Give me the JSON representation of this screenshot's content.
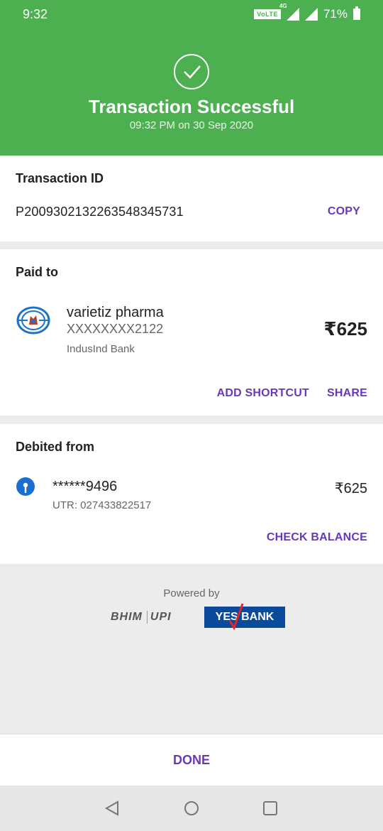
{
  "status_bar": {
    "time": "9:32",
    "volte": "VoLTE",
    "network": "4G",
    "battery": "71%"
  },
  "header": {
    "title": "Transaction Successful",
    "timestamp": "09:32 PM on 30 Sep 2020",
    "icon": "check-icon"
  },
  "transaction": {
    "title": "Transaction ID",
    "id": "P2009302132263548345731",
    "copy_label": "COPY"
  },
  "paid_to": {
    "title": "Paid to",
    "name": "varietiz pharma",
    "account": "XXXXXXXX2122",
    "bank": "IndusInd Bank",
    "amount": "₹625",
    "add_shortcut_label": "ADD SHORTCUT",
    "share_label": "SHARE"
  },
  "debited_from": {
    "title": "Debited from",
    "account": "******9496",
    "utr": "UTR: 027433822517",
    "amount": "₹625",
    "check_balance_label": "CHECK BALANCE"
  },
  "powered": {
    "label": "Powered by",
    "bhim": "BHIM",
    "upi": "UPI",
    "yes_bank": "YES BANK"
  },
  "done_label": "DONE",
  "colors": {
    "header_green": "#4caf50",
    "accent_purple": "#6739b7",
    "yes_bank_blue": "#0a4a9c"
  }
}
